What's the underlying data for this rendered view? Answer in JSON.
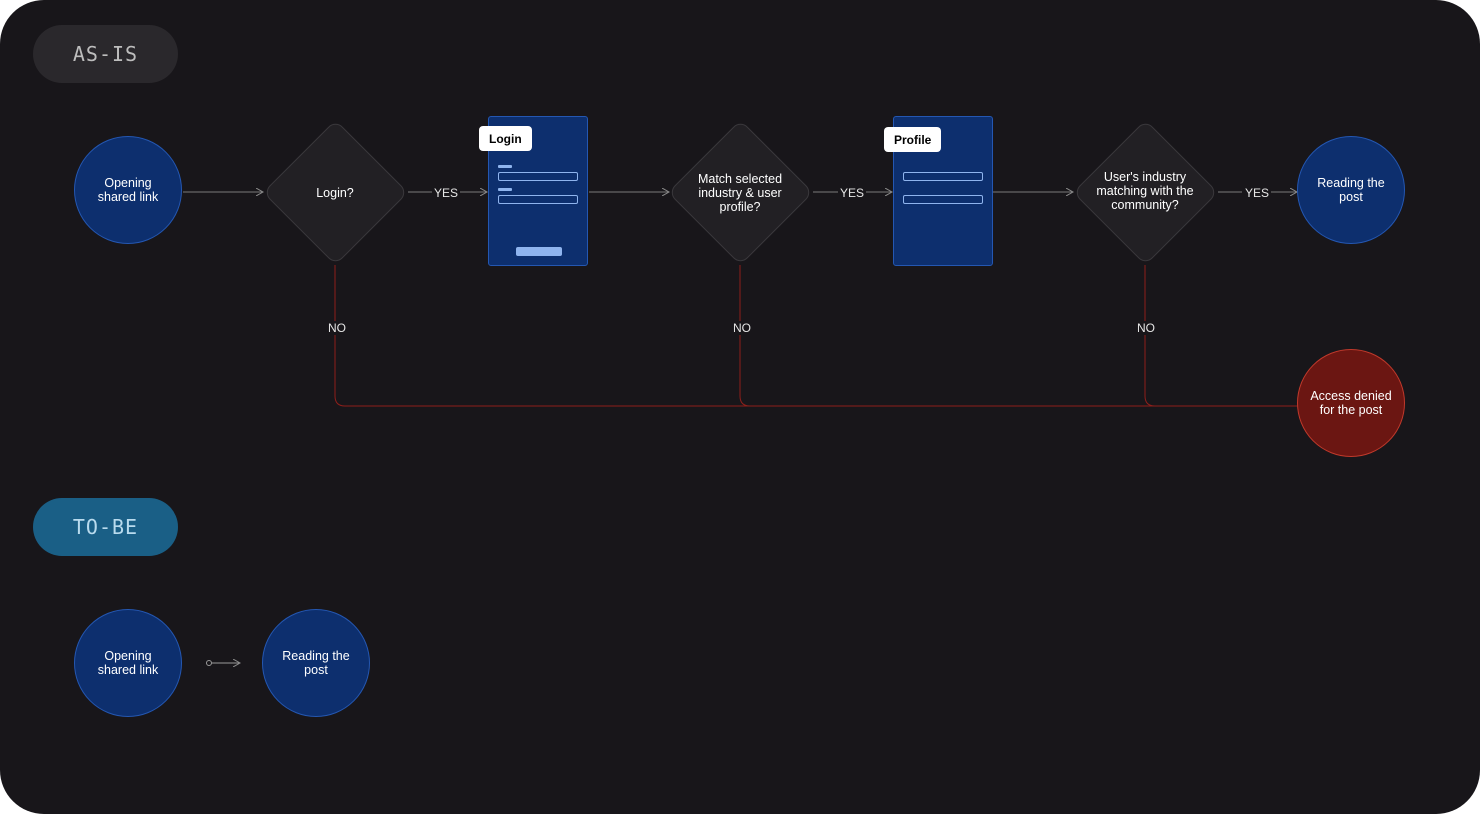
{
  "sections": {
    "as_is": "AS-IS",
    "to_be": "TO-BE"
  },
  "as_is": {
    "start": "Opening shared link",
    "decision_login": "Login?",
    "screen_login": "Login",
    "decision_match": "Match selected industry & user profile?",
    "screen_profile": "Profile",
    "decision_industry": "User's industry matching with the community?",
    "end_success": "Reading the post",
    "end_denied": "Access denied for the post",
    "yes": "YES",
    "no": "NO"
  },
  "to_be": {
    "start": "Opening shared link",
    "end": "Reading the post"
  },
  "colors": {
    "background": "#18161a",
    "node_blue": "#0d2f6e",
    "node_red": "#6b1612",
    "line_gray": "#7a7a7a",
    "line_red": "#8e1f1a",
    "tobe_pill": "#1a5f86"
  }
}
